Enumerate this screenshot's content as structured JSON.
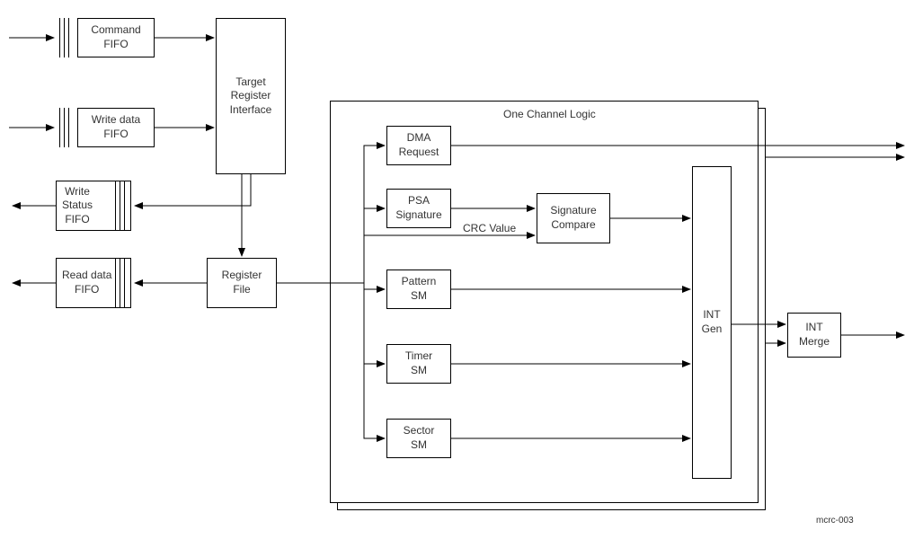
{
  "blocks": {
    "command_fifo": "Command\nFIFO",
    "write_data_fifo": "Write data\nFIFO",
    "write_status_fifo": "Write\nStatus\nFIFO",
    "read_data_fifo": "Read data\nFIFO",
    "target_register_interface": "Target\nRegister\nInterface",
    "register_file": "Register\nFile",
    "dma_request": "DMA\nRequest",
    "psa_signature": "PSA\nSignature",
    "signature_compare": "Signature\nCompare",
    "pattern_sm": "Pattern\nSM",
    "timer_sm": "Timer\nSM",
    "sector_sm": "Sector\nSM",
    "int_gen": "INT\nGen",
    "int_merge": "INT\nMerge"
  },
  "labels": {
    "channel_title": "One Channel Logic",
    "crc_value": "CRC Value",
    "image_id": "mcrc-003"
  }
}
